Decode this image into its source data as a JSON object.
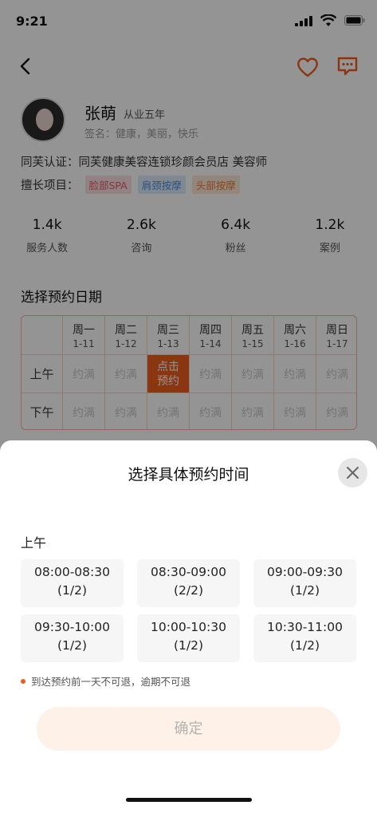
{
  "status_bar": {
    "time": "9:21"
  },
  "profile": {
    "name": "张萌",
    "experience": "从业五年",
    "signature": "签名：健康，美丽，快乐",
    "certification": "同芙认证：同芙健康美容连锁珍颜会员店    美容师",
    "skills_label": "擅长项目：",
    "skills": [
      {
        "label": "脸部SPA",
        "color": "#e35b6a"
      },
      {
        "label": "肩颈按摩",
        "color": "#4a8ee0"
      },
      {
        "label": "头部按摩",
        "color": "#ec7a36"
      }
    ]
  },
  "stats": [
    {
      "value": "1.4k",
      "label": "服务人数"
    },
    {
      "value": "2.6k",
      "label": "咨询"
    },
    {
      "value": "6.4k",
      "label": "粉丝"
    },
    {
      "value": "1.2k",
      "label": "案例"
    }
  ],
  "calendar": {
    "title": "选择预约日期",
    "days": [
      {
        "name": "周一",
        "date": "1-11"
      },
      {
        "name": "周二",
        "date": "1-12"
      },
      {
        "name": "周三",
        "date": "1-13"
      },
      {
        "name": "周四",
        "date": "1-14"
      },
      {
        "name": "周五",
        "date": "1-15"
      },
      {
        "name": "周六",
        "date": "1-16"
      },
      {
        "name": "周日",
        "date": "1-17"
      }
    ],
    "am_label": "上午",
    "pm_label": "下午",
    "full_label": "约满",
    "selected_label": "点击\n预约",
    "selected_day_index": 2,
    "accent": "#ee5d1c"
  },
  "sheet": {
    "title": "选择具体预约时间",
    "period_label": "上午",
    "slots": [
      {
        "time": "08:00-08:30",
        "count": "(1/2)"
      },
      {
        "time": "08:30-09:00",
        "count": "(2/2)"
      },
      {
        "time": "09:00-09:30",
        "count": "(1/2)"
      },
      {
        "time": "09:30-10:00",
        "count": "(1/2)"
      },
      {
        "time": "10:00-10:30",
        "count": "(1/2)"
      },
      {
        "time": "10:30-11:00",
        "count": "(1/2)"
      }
    ],
    "note": "到达预约前一天不可退，逾期不可退",
    "confirm_label": "确定"
  }
}
